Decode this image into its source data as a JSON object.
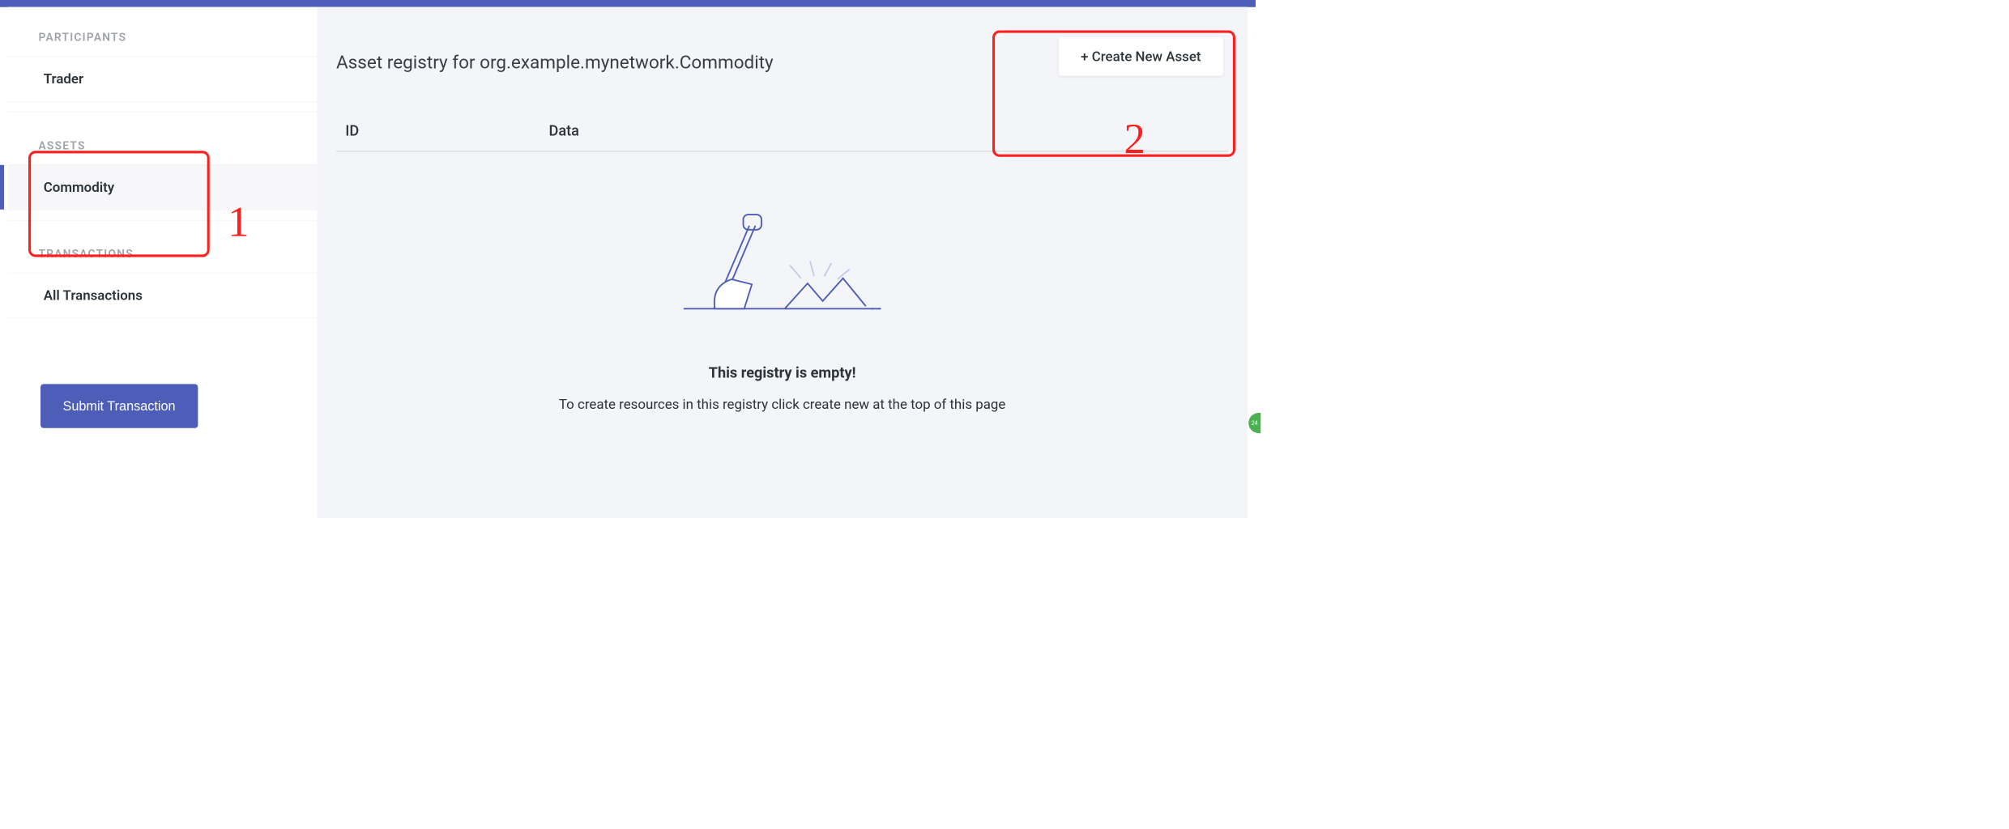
{
  "sidebar": {
    "sections": {
      "participants": {
        "label": "PARTICIPANTS",
        "items": [
          {
            "label": "Trader",
            "active": false
          }
        ]
      },
      "assets": {
        "label": "ASSETS",
        "items": [
          {
            "label": "Commodity",
            "active": true
          }
        ]
      },
      "transactions": {
        "label": "TRANSACTIONS",
        "items": [
          {
            "label": "All Transactions",
            "active": false
          }
        ]
      }
    },
    "submit_label": "Submit Transaction"
  },
  "main": {
    "title": "Asset registry for org.example.mynetwork.Commodity",
    "create_label": "+ Create New Asset",
    "columns": {
      "id": "ID",
      "data": "Data"
    },
    "empty": {
      "title": "This registry is empty!",
      "subtitle": "To create resources in this registry click create new at the top of this page"
    }
  },
  "annotations": {
    "one": "1",
    "two": "2",
    "badge": "24"
  }
}
